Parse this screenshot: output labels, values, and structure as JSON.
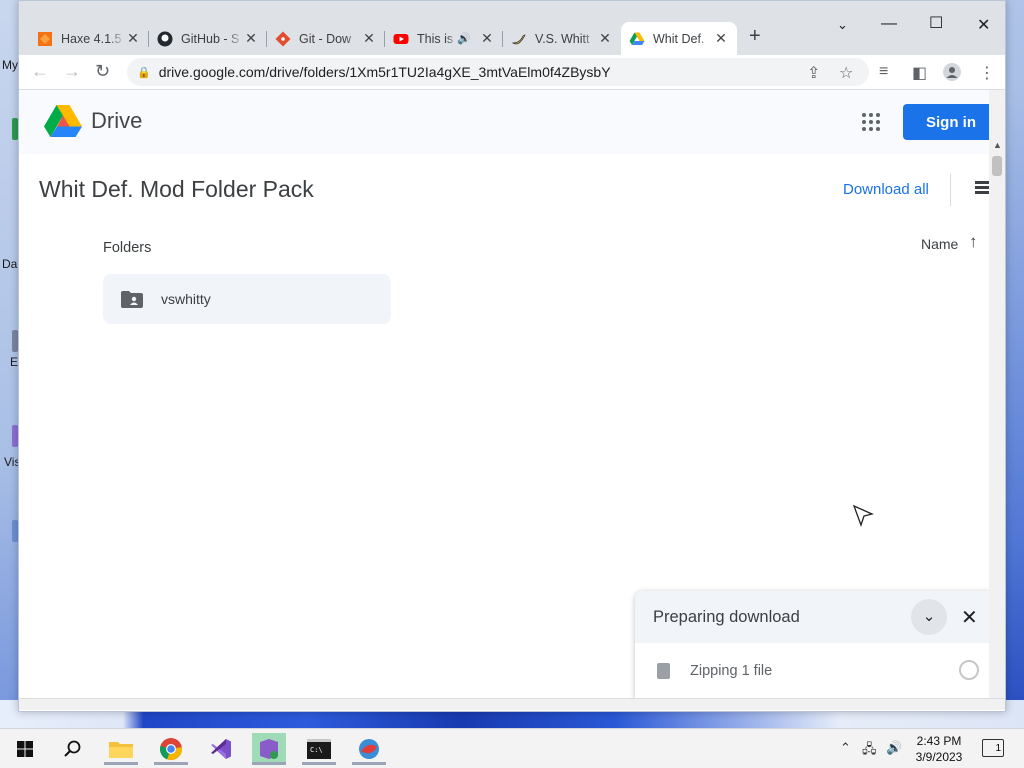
{
  "desktop": {
    "labels": [
      "My",
      "Da",
      "E",
      "Vis"
    ]
  },
  "tabs": [
    {
      "label": "Haxe 4.1.5",
      "icon": "haxe-icon",
      "color": "#f47216"
    },
    {
      "label": "GitHub - S",
      "icon": "github-icon",
      "color": "#24292f"
    },
    {
      "label": "Git - Dow",
      "icon": "git-icon",
      "color": "#e44c30"
    },
    {
      "label": "This is",
      "icon": "youtube-icon",
      "color": "#ff0000"
    },
    {
      "label": "V.S. Whitt",
      "icon": "banana-icon",
      "color": "#f5d142"
    },
    {
      "label": "Whit Def.",
      "icon": "drive-icon",
      "color": "#1a73e8"
    }
  ],
  "address_bar": {
    "url": "drive.google.com/drive/folders/1Xm5r1TU2Ia4gXE_3mtVaElm0f4ZBysbY"
  },
  "drive": {
    "product_name": "Drive",
    "sign_in_label": "Sign in",
    "folder_title": "Whit Def. Mod Folder Pack",
    "download_all_label": "Download all",
    "folders_label": "Folders",
    "sort_label": "Name",
    "folders": [
      {
        "name": "vswhitty"
      }
    ]
  },
  "download_panel": {
    "title": "Preparing download",
    "status": "Zipping 1 file"
  },
  "taskbar": {
    "time": "2:43 PM",
    "date": "3/9/2023",
    "notification_count": "1"
  },
  "colors": {
    "accent": "#1a73e8",
    "tab_strip": "#dee1e6"
  }
}
